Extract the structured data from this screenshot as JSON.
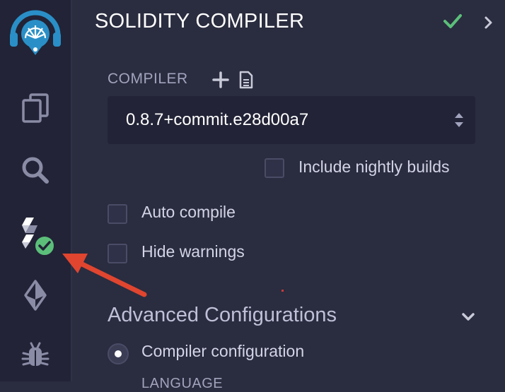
{
  "sidebar": {
    "icons": [
      {
        "name": "remix-logo-icon"
      },
      {
        "name": "file-explorer-icon"
      },
      {
        "name": "search-icon"
      },
      {
        "name": "solidity-compiler-icon"
      },
      {
        "name": "deploy-run-icon"
      },
      {
        "name": "debugger-icon"
      }
    ],
    "compile_status_badge": "success"
  },
  "header": {
    "title": "SOLIDITY COMPILER",
    "status_icon": "check-icon",
    "collapse_icon": "chevron-right-icon"
  },
  "compiler": {
    "label": "COMPILER",
    "add_icon": "plus-icon",
    "custom_file_icon": "file-text-icon",
    "selected_version": "0.8.7+commit.e28d00a7"
  },
  "options": {
    "include_nightly": {
      "label": "Include nightly builds",
      "checked": false
    },
    "auto_compile": {
      "label": "Auto compile",
      "checked": false
    },
    "hide_warnings": {
      "label": "Hide warnings",
      "checked": false
    }
  },
  "advanced": {
    "title": "Advanced Configurations",
    "radio_label": "Compiler configuration",
    "radio_selected": true,
    "language_label": "LANGUAGE"
  },
  "colors": {
    "accent_green": "#5bbf7a",
    "arrow_red": "#e0452f",
    "brand_blue": "#2a8fc7"
  }
}
